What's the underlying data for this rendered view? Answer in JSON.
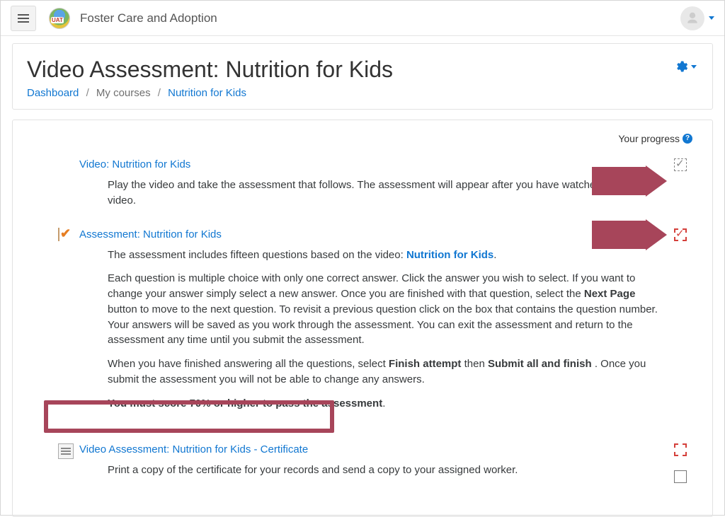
{
  "brand": "Foster Care and Adoption",
  "pageTitle": "Video Assessment: Nutrition for Kids",
  "breadcrumb": {
    "dashboard": "Dashboard",
    "myCourses": "My courses",
    "course": "Nutrition for Kids"
  },
  "progressLabel": "Your progress",
  "video": {
    "linkText": "Video: Nutrition for Kids",
    "desc": "Play the video and take the assessment that follows. The assessment will appear after you have watched all of the video."
  },
  "assessment": {
    "linkText": "Assessment: Nutrition for Kids",
    "p1a": "The assessment includes fifteen questions based on the video: ",
    "p1link": "Nutrition for Kids",
    "p1b": ".",
    "p2a": "Each question is multiple choice with only one correct answer.  Click the answer you wish to select.  If you want to change your answer simply select a new answer.  Once you are finished with that question, select the ",
    "p2bold1": "Next Page",
    "p2b": " button to move to the next question. To revisit a previous question click on the box that contains the question number. Your answers will be saved as you work through the assessment. You can exit the assessment and return to the assessment any time until you submit the assessment.",
    "p3a": "When you have finished answering all the questions, select ",
    "p3bold1": "Finish attempt",
    "p3mid": " then ",
    "p3bold2": "Submit all and finish",
    "p3b": ". Once you submit the assessment you will not be able to change any answers.",
    "p4": "You must score 70% or higher to pass the assessment"
  },
  "certificate": {
    "linkText": "Video Assessment: Nutrition for Kids - Certificate",
    "desc": "Print a copy of the certificate for your records and send a copy to your assigned worker."
  }
}
